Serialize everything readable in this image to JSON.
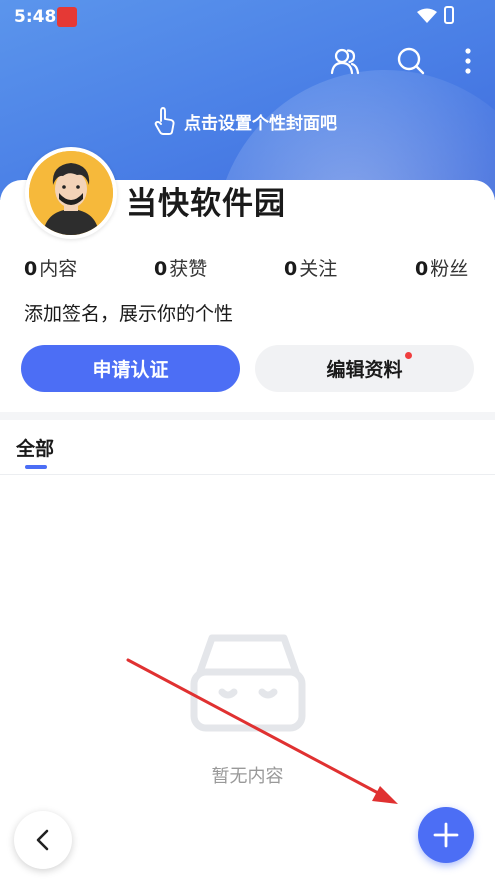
{
  "status_bar": {
    "time": "5:48"
  },
  "cover": {
    "hint": "点击设置个性封面吧"
  },
  "profile": {
    "username": "当快软件园",
    "bio": "添加签名，展示你的个性"
  },
  "stats": [
    {
      "count": "0",
      "label": "内容"
    },
    {
      "count": "0",
      "label": "获赞"
    },
    {
      "count": "0",
      "label": "关注"
    },
    {
      "count": "0",
      "label": "粉丝"
    }
  ],
  "actions": {
    "verify_label": "申请认证",
    "edit_label": "编辑资料"
  },
  "tabs": [
    {
      "label": "全部"
    }
  ],
  "empty_state": {
    "text": "暂无内容"
  },
  "icons": [
    "friends-icon",
    "search-icon",
    "more-icon",
    "tap-hand-icon",
    "empty-box-icon",
    "back-icon",
    "plus-icon"
  ],
  "colors": {
    "accent": "#4c6ef5",
    "cover": "#4a7fe6",
    "badge": "#f03e3e",
    "annotation_arrow": "#e03131"
  }
}
